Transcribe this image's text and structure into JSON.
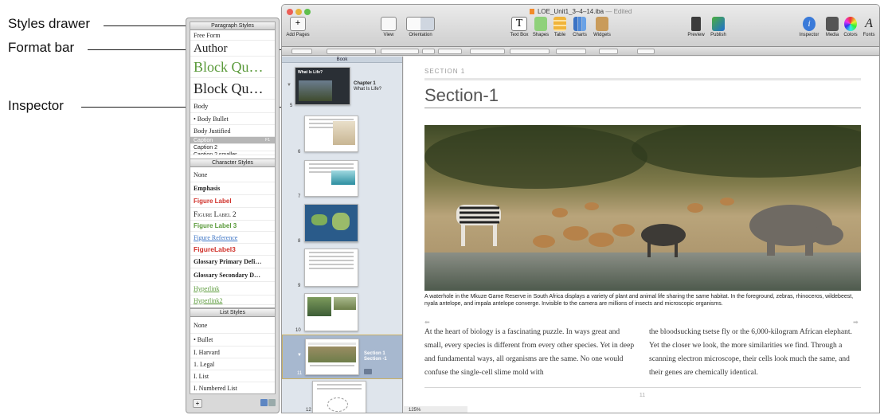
{
  "callouts": {
    "styles_drawer": "Styles drawer",
    "format_bar": "Format bar",
    "inspector": "Inspector"
  },
  "drawer": {
    "paragraph_header": "Paragraph Styles",
    "paragraph_styles": [
      "Free Form",
      "Author",
      "Block Qu…",
      "Block Qu…",
      "Body",
      "• Body Bullet",
      "Body Justified",
      "Caption",
      "Caption 2",
      "Caption 2 smaller"
    ],
    "caption_shortcut": "F1",
    "character_header": "Character Styles",
    "character_styles": [
      "None",
      "Emphasis",
      "Figure Label",
      "Figure Label 2",
      "Figure Label 3",
      "Figure Reference",
      "FigureLabel3",
      "Glossary Primary Defi…",
      "Glossary Secondary D…",
      "Hyperlink",
      "Hyperlink2"
    ],
    "list_header": "List Styles",
    "list_styles": [
      "None",
      "• Bullet",
      "I. Harvard",
      "1. Legal",
      "I. List",
      "I. Numbered List"
    ],
    "add_label": "+"
  },
  "window": {
    "title": "LOE_Unit1_3–4–14.iba",
    "edited": "— Edited"
  },
  "toolbar": {
    "add_pages": "Add Pages",
    "view": "View",
    "orientation": "Orientation",
    "text_box": "Text Box",
    "shapes": "Shapes",
    "table": "Table",
    "charts": "Charts",
    "widgets": "Widgets",
    "preview": "Preview",
    "publish": "Publish",
    "inspector": "Inspector",
    "media": "Media",
    "colors": "Colors",
    "fonts": "Fonts"
  },
  "sidebar": {
    "book_label": "Book",
    "chapter_title": "Chapter 1",
    "chapter_subtitle": "What Is Life?",
    "thumb_banner": "What Is Life?",
    "section_title": "Section 1",
    "section_subtitle": "Section -1",
    "page_numbers": [
      "5",
      "6",
      "7",
      "8",
      "9",
      "10",
      "11",
      "12"
    ]
  },
  "document": {
    "section_label": "SECTION 1",
    "section_title": "Section-1",
    "caption": "A waterhole in the Mkuze Game Reserve in South Africa displays a variety of plant and animal life sharing the same habitat. In the foreground, zebras, rhinoceros, wildebeest, nyala antelope, and impala antelope converge. Invisible to the camera are millions of insects and microscopic organisms.",
    "col1": "At the heart of biology is a fascinating puzzle. In ways great and small, every species is different from every other species. Yet in deep and fundamental ways, all organisms are the same. No one would confuse the single-cell slime mold with",
    "col2": "the bloodsucking tsetse fly or the 6,000-kilogram African elephant. Yet the closer we look, the more similarities we find. Through a scanning electron microscope, their cells look much the same, and their genes are chemically identical.",
    "page_number": "11"
  },
  "status": {
    "zoom": "125%"
  },
  "colors": {
    "selection_blue": "#a7b8cf",
    "figure_label_red": "#d0322b",
    "green_style": "#5a9a3a",
    "link_blue": "#3b73c4"
  }
}
